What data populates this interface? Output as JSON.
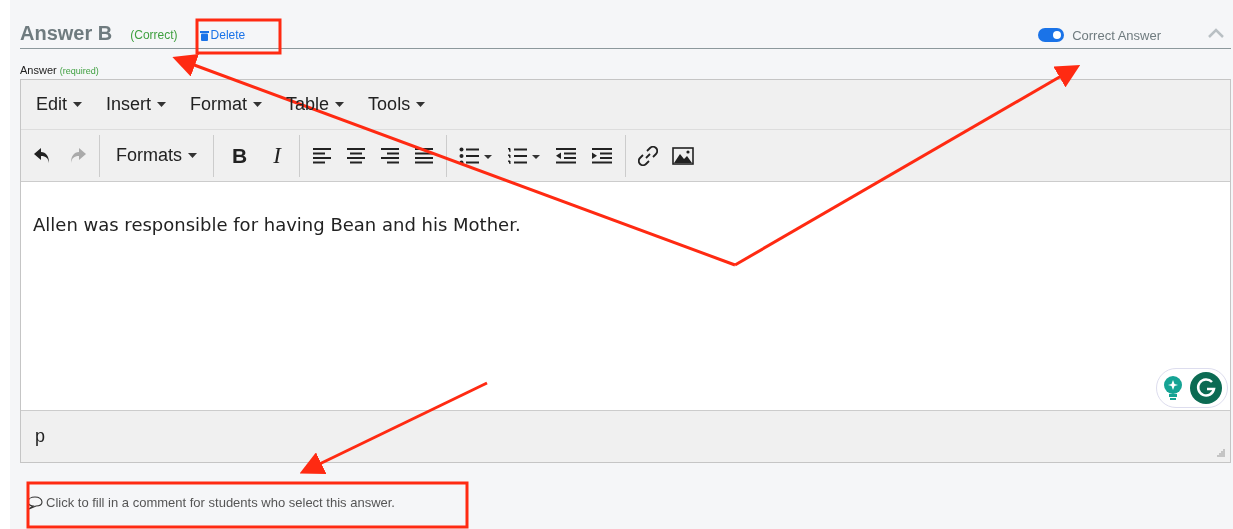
{
  "header": {
    "title": "Answer B",
    "status": "(Correct)",
    "delete": "Delete",
    "toggle": {
      "label": "Correct Answer",
      "on": true
    }
  },
  "field": {
    "label": "Answer",
    "required": "(required)"
  },
  "menus": [
    "Edit",
    "Insert",
    "Format",
    "Table",
    "Tools"
  ],
  "toolbar": {
    "undo_disabled": false,
    "redo_disabled": true,
    "formats": "Formats",
    "bold": "B",
    "italic": "I"
  },
  "content": "Allen was responsible for having Bean and his Mother.",
  "status_path": "p",
  "comment": {
    "placeholder": "Click to fill in a comment for students who select this answer."
  }
}
